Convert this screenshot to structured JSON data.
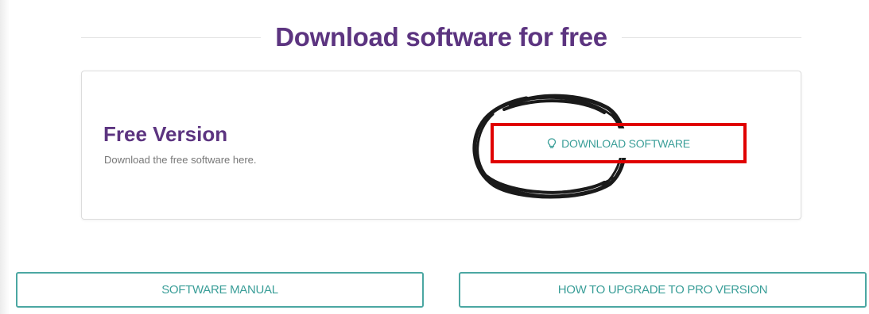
{
  "heading": {
    "title": "Download software for free"
  },
  "card": {
    "title": "Free Version",
    "subtitle": "Download the free software here.",
    "download_button": {
      "label": "DOWNLOAD SOFTWARE",
      "icon": "lightbulb-icon"
    }
  },
  "buttons": {
    "manual": "SOFTWARE MANUAL",
    "upgrade": "HOW TO UPGRADE TO PRO VERSION"
  },
  "colors": {
    "heading_purple": "#5c3480",
    "teal": "#3a9e98",
    "highlight_red": "#e00000"
  }
}
